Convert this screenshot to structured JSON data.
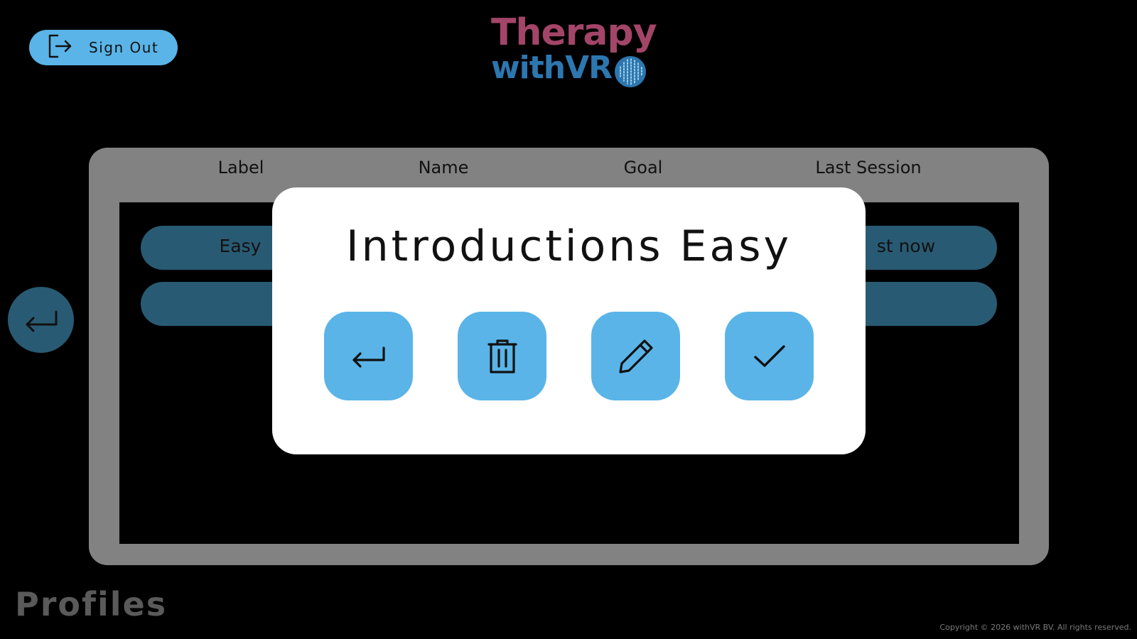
{
  "header": {
    "signout_label": "Sign Out",
    "logo": {
      "line1": "Therapy",
      "line2": "withVR",
      "line1_color": "#a34569",
      "line2_color": "#2d77b0"
    }
  },
  "table": {
    "columns": [
      "Label",
      "Name",
      "Goal",
      "Last Session"
    ],
    "rows": [
      {
        "label": "Easy",
        "last_session": "st now"
      },
      {
        "label": "",
        "last_session": ""
      }
    ]
  },
  "page": {
    "title": "Profiles",
    "copyright": "Copyright © 2026 withVR BV. All rights reserved."
  },
  "modal": {
    "title": "Introductions Easy",
    "actions": [
      {
        "name": "back",
        "icon": "return-arrow-icon"
      },
      {
        "name": "delete",
        "icon": "trash-icon"
      },
      {
        "name": "edit",
        "icon": "pencil-icon"
      },
      {
        "name": "confirm",
        "icon": "checkmark-icon"
      }
    ]
  },
  "colors": {
    "accent": "#5ab4e8",
    "accent_dimmed": "#295a73",
    "panel": "#828282",
    "background": "#000000"
  }
}
